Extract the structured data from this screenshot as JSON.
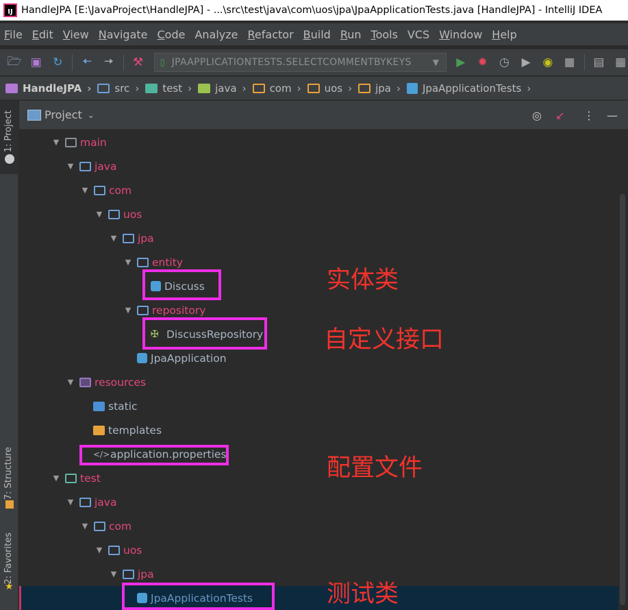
{
  "window": {
    "title": "HandleJPA [E:\\JavaProject\\HandleJPA] - ...\\src\\test\\java\\com\\uos\\jpa\\JpaApplicationTests.java [HandleJPA] - IntelliJ IDEA",
    "app_icon": "IJ"
  },
  "menu": {
    "items": [
      {
        "u": "F",
        "rest": "ile"
      },
      {
        "u": "E",
        "rest": "dit"
      },
      {
        "u": "V",
        "rest": "iew"
      },
      {
        "u": "N",
        "rest": "avigate"
      },
      {
        "u": "C",
        "rest": "ode"
      },
      {
        "u": "",
        "rest": "Analyze"
      },
      {
        "u": "R",
        "rest": "efactor"
      },
      {
        "u": "B",
        "rest": "uild"
      },
      {
        "u": "R",
        "rest": "un"
      },
      {
        "u": "T",
        "rest": "ools"
      },
      {
        "u": "",
        "rest": "VCS"
      },
      {
        "u": "W",
        "rest": "indow"
      },
      {
        "u": "H",
        "rest": "elp"
      }
    ]
  },
  "toolbar": {
    "run_config": "JPAAPPLICATIONTESTS.SELECTCOMMENTBYKEYS"
  },
  "breadcrumb": {
    "items": [
      "HandleJPA",
      "src",
      "test",
      "java",
      "com",
      "uos",
      "jpa",
      "JpaApplicationTests"
    ]
  },
  "sidebar": {
    "project_tab": "1: Project",
    "structure_tab": "7: Structure",
    "favorites_tab": "2: Favorites"
  },
  "panel": {
    "title": "Project"
  },
  "tree": {
    "main": "main",
    "java": "java",
    "com": "com",
    "uos": "uos",
    "jpa": "jpa",
    "entity": "entity",
    "discuss": "Discuss",
    "repository": "repository",
    "discuss_repository": "DiscussRepository",
    "jpa_application": "JpaApplication",
    "resources": "resources",
    "static": "static",
    "templates": "templates",
    "application_properties": "application.properties",
    "test": "test",
    "test_java": "java",
    "test_com": "com",
    "test_uos": "uos",
    "test_jpa": "jpa",
    "jpa_application_tests": "JpaApplicationTests"
  },
  "annotations": {
    "entity_class": "实体类",
    "custom_interface": "自定义接口",
    "config_file": "配置文件",
    "test_class": "测试类"
  },
  "colors": {
    "highlight": "#ee2de6",
    "annotation": "#f0332c",
    "folder_name": "#e5487b"
  }
}
